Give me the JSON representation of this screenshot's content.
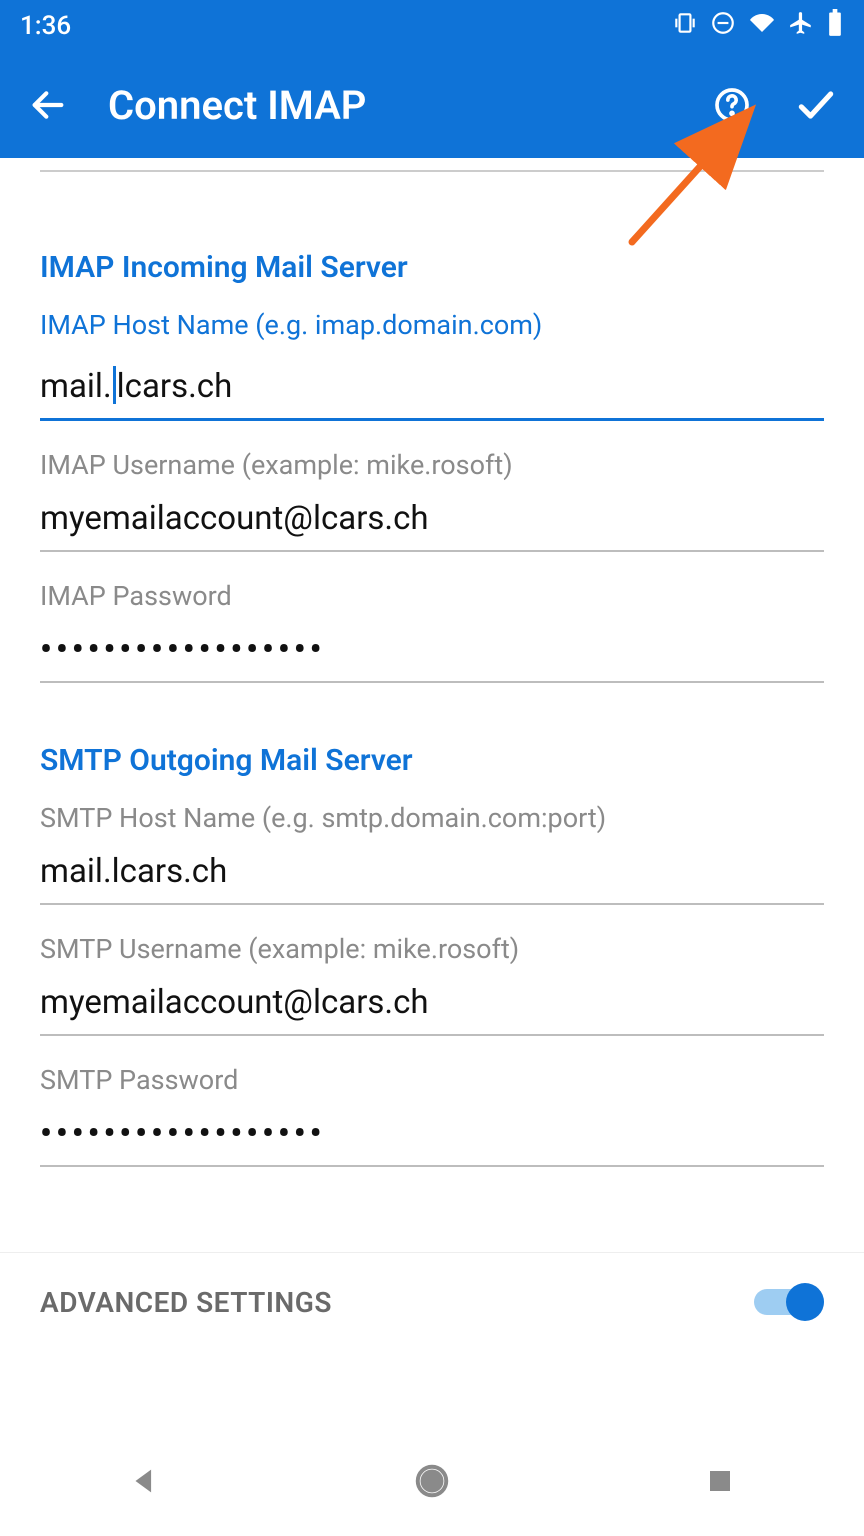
{
  "status": {
    "time": "1:36"
  },
  "header": {
    "title": "Connect IMAP"
  },
  "imap": {
    "section_title": "IMAP Incoming Mail Server",
    "host_label": "IMAP Host Name (e.g. imap.domain.com)",
    "host_value": "mail.lcars.ch",
    "user_label": "IMAP Username (example: mike.rosoft)",
    "user_value": "myemailaccount@lcars.ch",
    "pw_label": "IMAP Password",
    "pw_value": "••••••••••••••••••"
  },
  "smtp": {
    "section_title": "SMTP Outgoing Mail Server",
    "host_label": "SMTP Host Name (e.g. smtp.domain.com:port)",
    "host_value": "mail.lcars.ch",
    "user_label": "SMTP Username (example: mike.rosoft)",
    "user_value": "myemailaccount@lcars.ch",
    "pw_label": "SMTP Password",
    "pw_value": "••••••••••••••••••"
  },
  "advanced": {
    "label": "ADVANCED SETTINGS",
    "enabled": true
  }
}
